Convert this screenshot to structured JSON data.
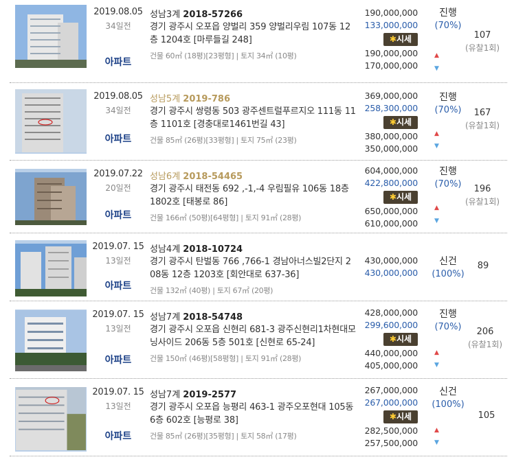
{
  "items": [
    {
      "date": "2019.08.05",
      "days_ago": "34일전",
      "court": "성남3계",
      "case_no": "2018-57266",
      "address": "경기 광주시 오포읍 양벌리 359 양벌리우림 107동 12층 1204호 [마루들길 248]",
      "area": "건물 60㎡ (18평)[23평형] | 토지 34㎡ (10평)",
      "type": "아파트",
      "appraisal": "190,000,000",
      "min_bid": "133,000,000",
      "market_label": "시세",
      "market_high": "190,000,000",
      "market_low": "170,000,000",
      "status": "진행",
      "percent": "(70%)",
      "views": "107",
      "fail_count": "(유찰1회)"
    },
    {
      "date": "2019.08.05",
      "days_ago": "34일전",
      "court": "성남5계",
      "case_no": "2019-786",
      "address": "경기 광주시 쌍령동 503 광주센트럴푸르지오 111동 11층 1101호 [경충대로1461번길 43]",
      "area": "건물 85㎡ (26평)[33평형] | 토지 75㎡ (23평)",
      "type": "아파트",
      "appraisal": "369,000,000",
      "min_bid": "258,300,000",
      "market_label": "시세",
      "market_high": "380,000,000",
      "market_low": "350,000,000",
      "status": "진행",
      "percent": "(70%)",
      "views": "167",
      "fail_count": "(유찰1회)"
    },
    {
      "date": "2019.07.22",
      "days_ago": "20일전",
      "court": "성남6계",
      "case_no": "2018-54465",
      "address": "경기 광주시 태전동 692 ,-1,-4 우림필유 106동 18층 1802호 [태봉로 86]",
      "area": "건물 166㎡ (50평)[64평형] | 토지 91㎡ (28평)",
      "type": "아파트",
      "appraisal": "604,000,000",
      "min_bid": "422,800,000",
      "market_label": "시세",
      "market_high": "650,000,000",
      "market_low": "610,000,000",
      "status": "진행",
      "percent": "(70%)",
      "views": "196",
      "fail_count": "(유찰1회)"
    },
    {
      "date": "2019.07. 15",
      "days_ago": "13일전",
      "court": "성남4계",
      "case_no": "2018-10724",
      "address": "경기 광주시 탄벌동 766 ,766-1 경남아너스빌2단지 208동 12층 1203호 [회안대로 637-36]",
      "area": "건물 132㎡ (40평) | 토지 67㎡ (20평)",
      "type": "아파트",
      "appraisal": "430,000,000",
      "min_bid": "430,000,000",
      "market_label": "",
      "market_high": "",
      "market_low": "",
      "status": "신건",
      "percent": "(100%)",
      "views": "89",
      "fail_count": ""
    },
    {
      "date": "2019.07. 15",
      "days_ago": "13일전",
      "court": "성남7계",
      "case_no": "2018-54748",
      "address": "경기 광주시 오포읍 신현리 681-3 광주신현리1차현대모닝사이드 206동 5층 501호 [신현로 65-24]",
      "area": "건물 150㎡ (46평)[58평형] | 토지 91㎡ (28평)",
      "type": "아파트",
      "appraisal": "428,000,000",
      "min_bid": "299,600,000",
      "market_label": "시세",
      "market_high": "440,000,000",
      "market_low": "405,000,000",
      "status": "진행",
      "percent": "(70%)",
      "views": "206",
      "fail_count": "(유찰1회)"
    },
    {
      "date": "2019.07. 15",
      "days_ago": "13일전",
      "court": "성남7계",
      "case_no": "2019-2577",
      "address": "경기 광주시 오포읍 능평리 463-1 광주오포현대 105동 6층 602호 [능평로 38]",
      "area": "건물 85㎡ (26평)[35평형] | 토지 58㎡ (17평)",
      "type": "아파트",
      "appraisal": "267,000,000",
      "min_bid": "267,000,000",
      "market_label": "시세",
      "market_high": "282,500,000",
      "market_low": "257,500,000",
      "status": "신건",
      "percent": "(100%)",
      "views": "105",
      "fail_count": ""
    }
  ],
  "colors": {
    "link_blue": "#1a3f86",
    "price_blue": "#2a5daa",
    "sale_gold": "#b79a5c",
    "up_red": "#e04848",
    "down_blue": "#5aa5e0"
  }
}
